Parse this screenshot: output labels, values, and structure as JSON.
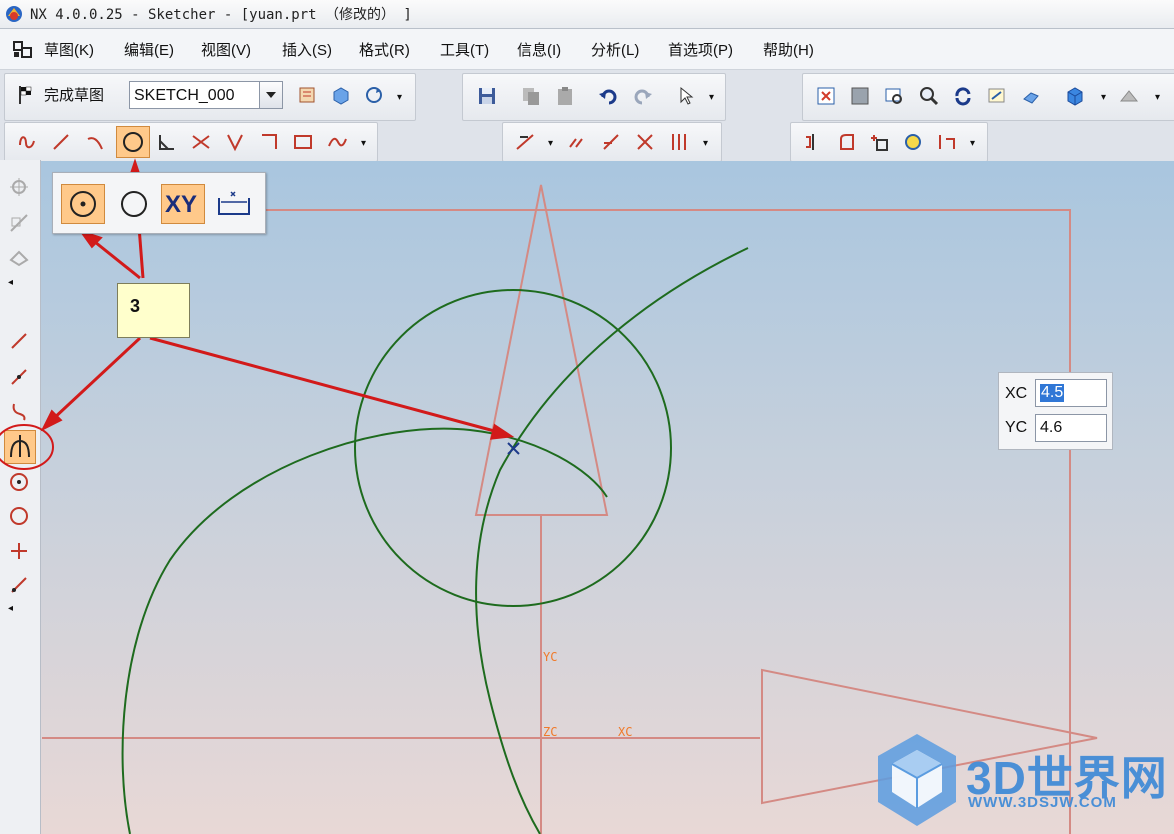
{
  "window": {
    "title": "NX 4.0.0.25 - Sketcher - [yuan.prt （修改的） ]"
  },
  "menu": {
    "items": [
      "草图(K)",
      "编辑(E)",
      "视图(V)",
      "插入(S)",
      "格式(R)",
      "工具(T)",
      "信息(I)",
      "分析(L)",
      "首选项(P)",
      "帮助(H)"
    ]
  },
  "sketch_toolbar": {
    "finish_label": "完成草图",
    "sketch_name": "SKETCH_000"
  },
  "point_popup": {
    "xy_label": "XY"
  },
  "callout": {
    "label": "3"
  },
  "coord_input": {
    "xc_label": "XC",
    "xc_value": "4.5",
    "yc_label": "YC",
    "yc_value": "4.6"
  },
  "axes": {
    "yc": "YC",
    "zc": "ZC",
    "xc": "XC"
  },
  "watermark": {
    "title": "3D世界网",
    "url": "WWW.3DSJW.COM"
  },
  "colors": {
    "curve": "#1e6b1e",
    "datum": "#d48a84",
    "annotation_arrow": "#d21a1a",
    "selected": "#ffc98a"
  }
}
